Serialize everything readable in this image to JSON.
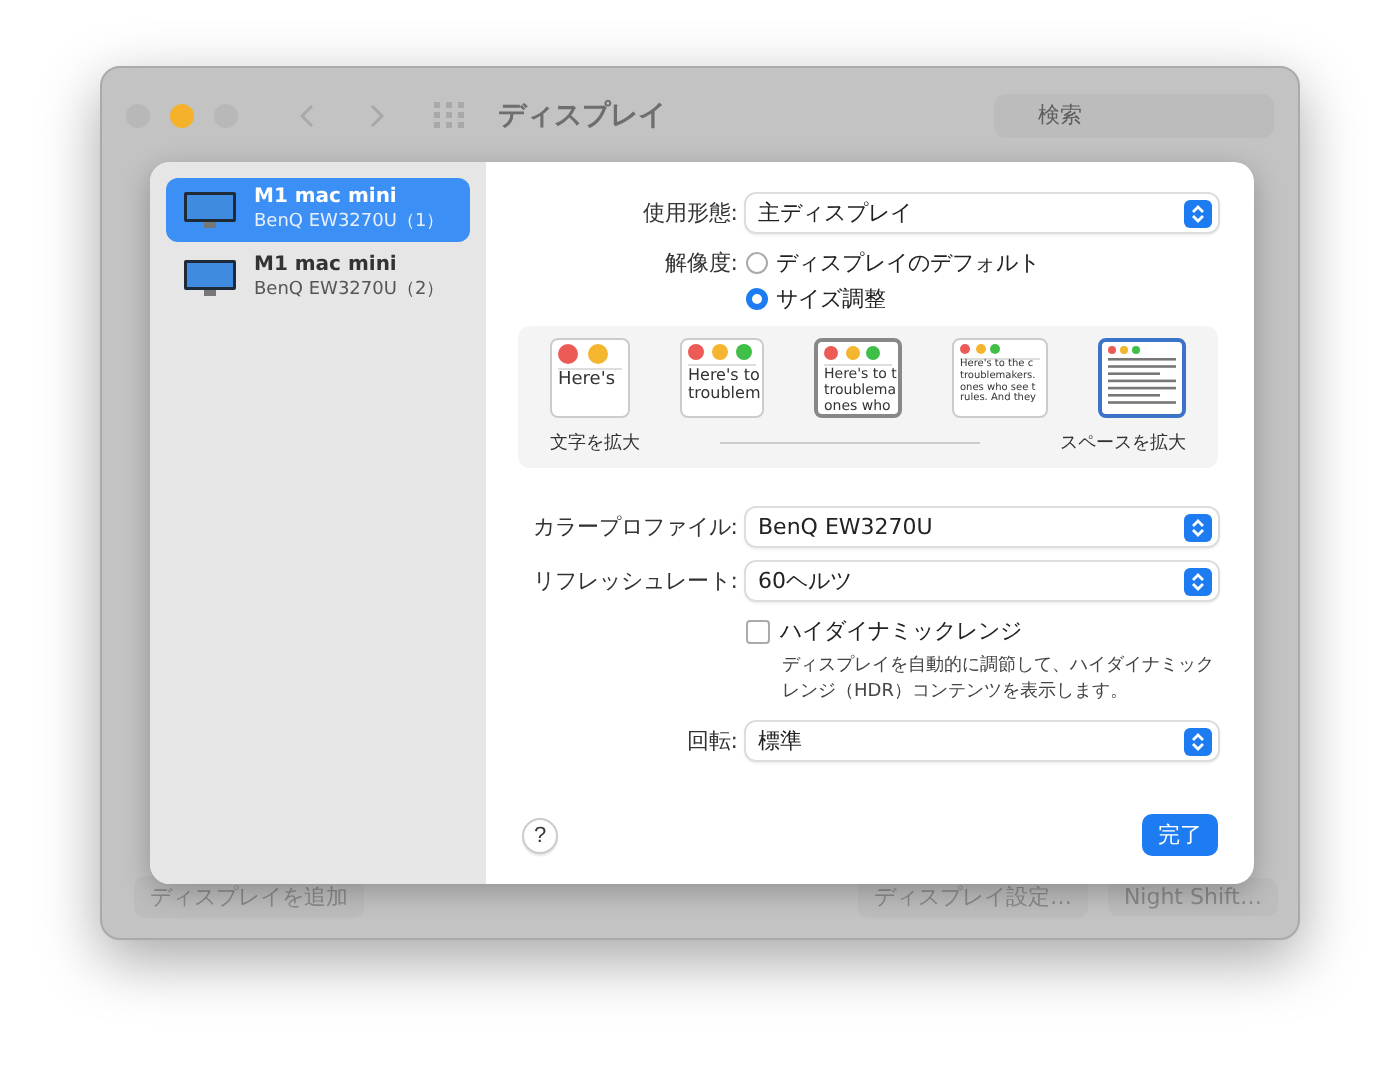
{
  "window": {
    "title": "ディスプレイ",
    "search": {
      "placeholder": "検索"
    },
    "footer_buttons": [
      "ディスプレイを追加",
      "ディスプレイ設定…",
      "Night Shift…"
    ]
  },
  "sidebar": {
    "items": [
      {
        "name": "M1 mac mini",
        "model": "BenQ EW3270U（1）",
        "selected": true
      },
      {
        "name": "M1 mac mini",
        "model": "BenQ EW3270U（2）",
        "selected": false
      }
    ]
  },
  "settings": {
    "usage": {
      "label": "使用形態:",
      "value": "主ディスプレイ"
    },
    "resolution": {
      "label": "解像度:",
      "options": [
        {
          "label": "ディスプレイのデフォルト",
          "selected": false
        },
        {
          "label": "サイズ調整",
          "selected": true
        }
      ]
    },
    "scales": [
      {
        "lines": [
          "Here's"
        ],
        "selected": false,
        "current": false
      },
      {
        "lines": [
          "Here's to",
          "troublem"
        ],
        "selected": false,
        "current": false
      },
      {
        "lines": [
          "Here's to t",
          "troublema",
          "ones who"
        ],
        "selected": false,
        "current": true
      },
      {
        "lines": [
          "Here's to the c",
          "troublemakers.",
          "ones who see t",
          "rules. And they"
        ],
        "selected": false,
        "current": false
      },
      {
        "selected": true,
        "current": false
      }
    ],
    "scale_min_label": "文字を拡大",
    "scale_max_label": "スペースを拡大",
    "color_profile": {
      "label": "カラープロファイル:",
      "value": "BenQ EW3270U"
    },
    "refresh_rate": {
      "label": "リフレッシュレート:",
      "value": "60ヘルツ"
    },
    "hdr": {
      "label": "ハイダイナミックレンジ",
      "checked": false,
      "description": "ディスプレイを自動的に調節して、ハイダイナミックレンジ（HDR）コンテンツを表示します。"
    },
    "rotation": {
      "label": "回転:",
      "value": "標準"
    }
  },
  "help": "?",
  "done": "完了"
}
